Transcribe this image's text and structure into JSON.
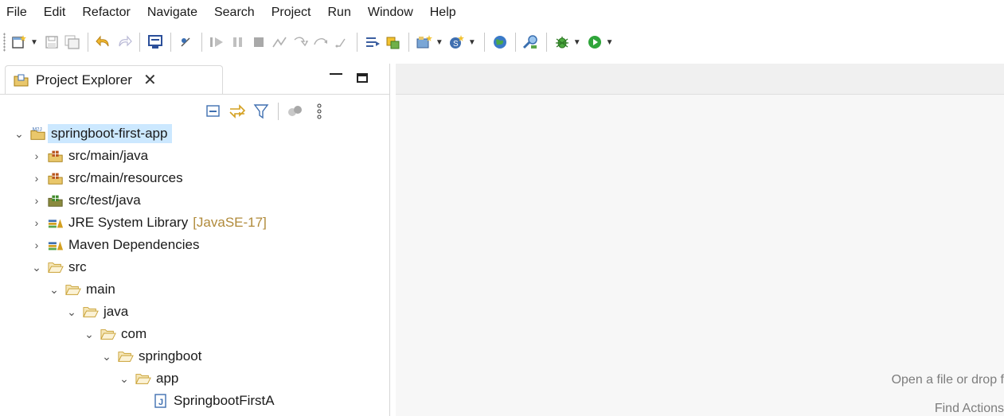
{
  "menubar": {
    "items": [
      "File",
      "Edit",
      "Refactor",
      "Navigate",
      "Search",
      "Project",
      "Run",
      "Window",
      "Help"
    ]
  },
  "toolbar": {
    "icons": [
      "new-icon",
      "save-icon",
      "save-all-icon",
      "undo-icon",
      "redo-icon",
      "console-icon",
      "skip-breakpoints-icon",
      "resume-icon",
      "suspend-icon",
      "terminate-icon",
      "disconnect-icon",
      "step-into-icon",
      "step-over-icon",
      "step-return-icon",
      "use-step-filters-icon",
      "open-type-icon",
      "new-java-project-icon",
      "new-java-class-icon",
      "web-browser-icon",
      "search-icon",
      "debug-icon",
      "run-icon"
    ]
  },
  "explorer": {
    "tab_label": "Project Explorer",
    "close_glyph": "✕"
  },
  "tree": [
    {
      "label": "springboot-first-app",
      "decoration": "",
      "expanded": true,
      "has_twisty": true,
      "icon": "maven-project-icon",
      "selected": true
    },
    {
      "label": "src/main/java",
      "decoration": "",
      "expanded": false,
      "has_twisty": true,
      "icon": "source-folder-icon"
    },
    {
      "label": "src/main/resources",
      "decoration": "",
      "expanded": false,
      "has_twisty": true,
      "icon": "source-folder-icon"
    },
    {
      "label": "src/test/java",
      "decoration": "",
      "expanded": false,
      "has_twisty": true,
      "icon": "test-source-folder-icon"
    },
    {
      "label": "JRE System Library",
      "decoration": "[JavaSE-17]",
      "expanded": false,
      "has_twisty": true,
      "icon": "library-icon"
    },
    {
      "label": "Maven Dependencies",
      "decoration": "",
      "expanded": false,
      "has_twisty": true,
      "icon": "library-icon"
    },
    {
      "label": "src",
      "decoration": "",
      "expanded": true,
      "has_twisty": true,
      "icon": "folder-icon"
    },
    {
      "label": "main",
      "decoration": "",
      "expanded": true,
      "has_twisty": true,
      "icon": "folder-icon"
    },
    {
      "label": "java",
      "decoration": "",
      "expanded": true,
      "has_twisty": true,
      "icon": "folder-icon"
    },
    {
      "label": "com",
      "decoration": "",
      "expanded": true,
      "has_twisty": true,
      "icon": "folder-icon"
    },
    {
      "label": "springboot",
      "decoration": "",
      "expanded": true,
      "has_twisty": true,
      "icon": "folder-icon"
    },
    {
      "label": "app",
      "decoration": "",
      "expanded": true,
      "has_twisty": true,
      "icon": "folder-icon"
    },
    {
      "label": "SpringbootFirstA",
      "decoration": "",
      "expanded": false,
      "has_twisty": false,
      "icon": "java-file-icon"
    }
  ],
  "editor": {
    "hint_open": "Open a file or drop f",
    "hint_find": "Find Actions"
  }
}
